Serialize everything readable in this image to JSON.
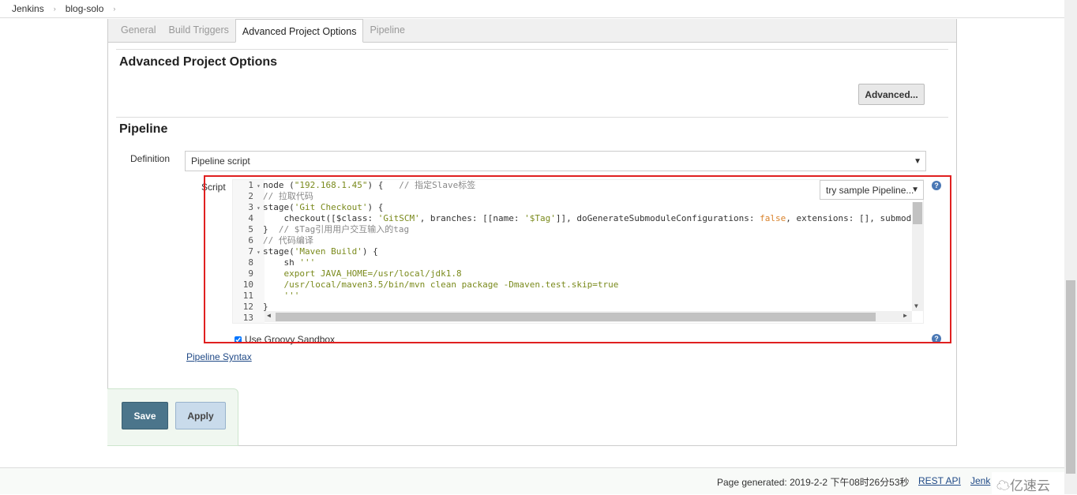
{
  "breadcrumb": [
    "Jenkins",
    "blog-solo"
  ],
  "tabs": [
    "General",
    "Build Triggers",
    "Advanced Project Options",
    "Pipeline"
  ],
  "active_tab": "Advanced Project Options",
  "advanced_section": {
    "title": "Advanced Project Options",
    "advanced_button": "Advanced..."
  },
  "pipeline": {
    "title": "Pipeline",
    "definition_label": "Definition",
    "definition_value": "Pipeline script",
    "script_label": "Script",
    "sample_select": "try sample Pipeline...",
    "sandbox_label": "Use Groovy Sandbox",
    "sandbox_checked": true,
    "syntax_link": "Pipeline Syntax"
  },
  "code_lines": [
    {
      "n": "1",
      "fold": true,
      "seg": [
        [
          "node (",
          "p"
        ],
        [
          "\"192.168.1.45\"",
          "s"
        ],
        [
          ") {   ",
          "p"
        ],
        [
          "// 指定Slave标签",
          "c"
        ]
      ]
    },
    {
      "n": "2",
      "seg": [
        [
          "// 拉取代码",
          "c"
        ]
      ]
    },
    {
      "n": "3",
      "fold": true,
      "seg": [
        [
          "stage(",
          "p"
        ],
        [
          "'Git Checkout'",
          "s"
        ],
        [
          ") {",
          "p"
        ]
      ]
    },
    {
      "n": "4",
      "seg": [
        [
          "    checkout([$class: ",
          "p"
        ],
        [
          "'GitSCM'",
          "s"
        ],
        [
          ", branches: [[name: ",
          "p"
        ],
        [
          "'$Tag'",
          "s"
        ],
        [
          "]], doGenerateSubmoduleConfigurations: ",
          "p"
        ],
        [
          "false",
          "k"
        ],
        [
          ", extensions: [], submod",
          "p"
        ]
      ]
    },
    {
      "n": "5",
      "seg": [
        [
          "}  ",
          "p"
        ],
        [
          "// $Tag引用用户交互输入的tag",
          "c"
        ]
      ]
    },
    {
      "n": "6",
      "seg": [
        [
          "// 代码编译",
          "c"
        ]
      ]
    },
    {
      "n": "7",
      "fold": true,
      "seg": [
        [
          "stage(",
          "p"
        ],
        [
          "'Maven Build'",
          "s"
        ],
        [
          ") {",
          "p"
        ]
      ]
    },
    {
      "n": "8",
      "seg": [
        [
          "    sh ",
          "p"
        ],
        [
          "'''",
          "s"
        ]
      ]
    },
    {
      "n": "9",
      "seg": [
        [
          "    export JAVA_HOME=/usr/local/jdk1.8",
          "s"
        ]
      ]
    },
    {
      "n": "10",
      "seg": [
        [
          "    /usr/local/maven3.5/bin/mvn clean package -Dmaven.test.skip=true",
          "s"
        ]
      ]
    },
    {
      "n": "11",
      "seg": [
        [
          "    '''",
          "s"
        ]
      ]
    },
    {
      "n": "12",
      "seg": [
        [
          "}",
          "p"
        ]
      ]
    },
    {
      "n": "13",
      "seg": []
    }
  ],
  "buttons": {
    "save": "Save",
    "apply": "Apply"
  },
  "footer": {
    "generated": "Page generated: 2019-2-2 下午08时26分53秒",
    "rest_api": "REST API",
    "jenkins": "Jenk"
  },
  "watermark": "亿速云",
  "colors": {
    "save": "#4b758b",
    "highlight_box": "#e02020"
  }
}
